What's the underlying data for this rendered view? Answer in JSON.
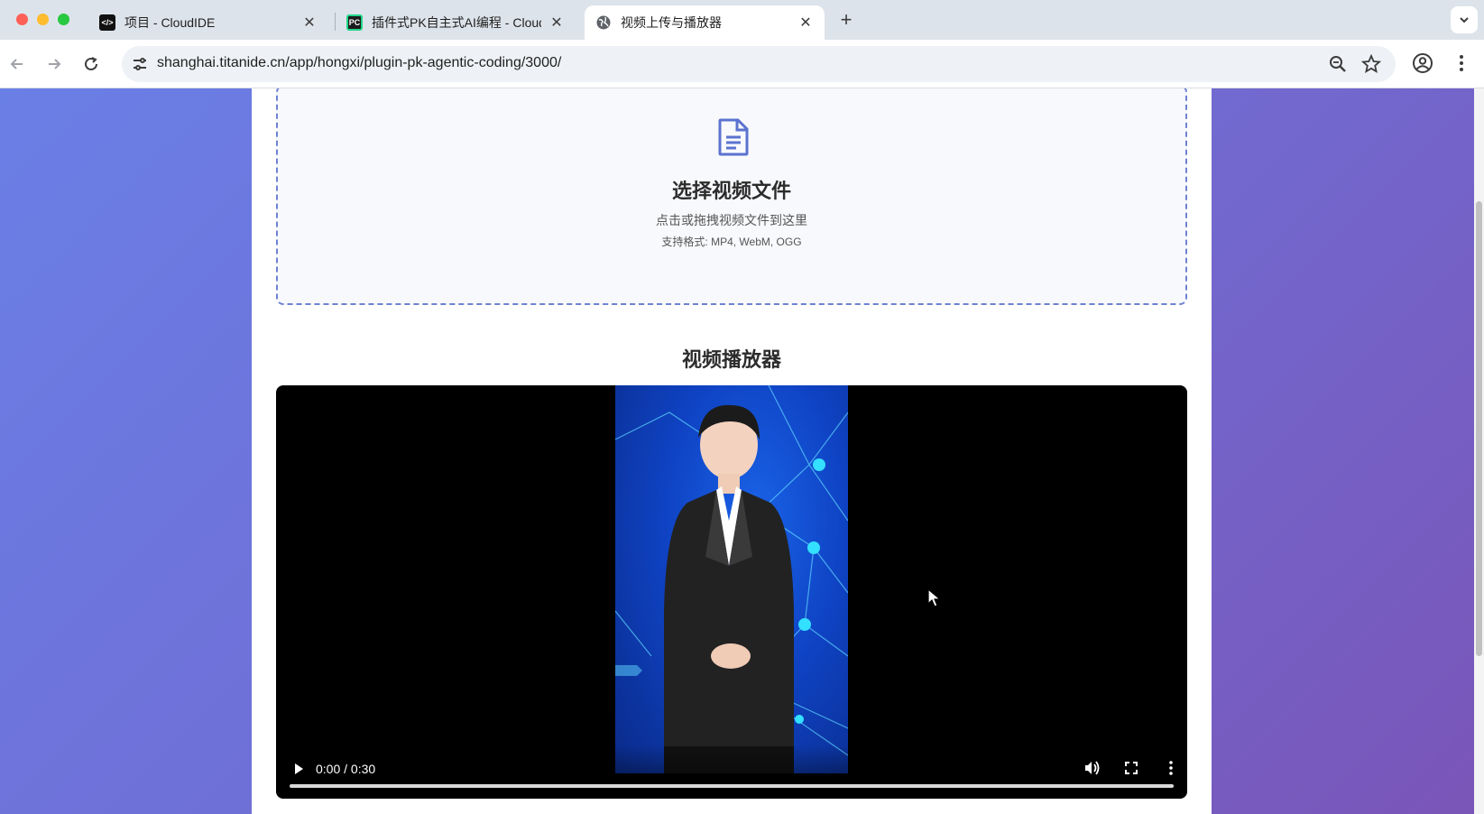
{
  "browser": {
    "tabs": [
      {
        "title": "项目 - CloudIDE",
        "favicon": "code-brackets-icon",
        "active": false
      },
      {
        "title": "插件式PK自主式AI编程 - Cloud",
        "favicon": "pycharm-icon",
        "active": false
      },
      {
        "title": "视频上传与播放器",
        "favicon": "globe-icon",
        "active": true
      }
    ],
    "close_glyph": "✕",
    "newtab_glyph": "+",
    "url": "shanghai.titanide.cn/app/hongxi/plugin-pk-agentic-coding/3000/"
  },
  "upload": {
    "title": "选择视频文件",
    "hint": "点击或拖拽视频文件到这里",
    "formats": "支持格式: MP4, WebM, OGG"
  },
  "player": {
    "title": "视频播放器",
    "time": "0:00 / 0:30",
    "progress": 0
  },
  "colors": {
    "accent": "#6e82d2",
    "background_gradient_start": "#6a7fe6",
    "background_gradient_end": "#7a55b8"
  }
}
